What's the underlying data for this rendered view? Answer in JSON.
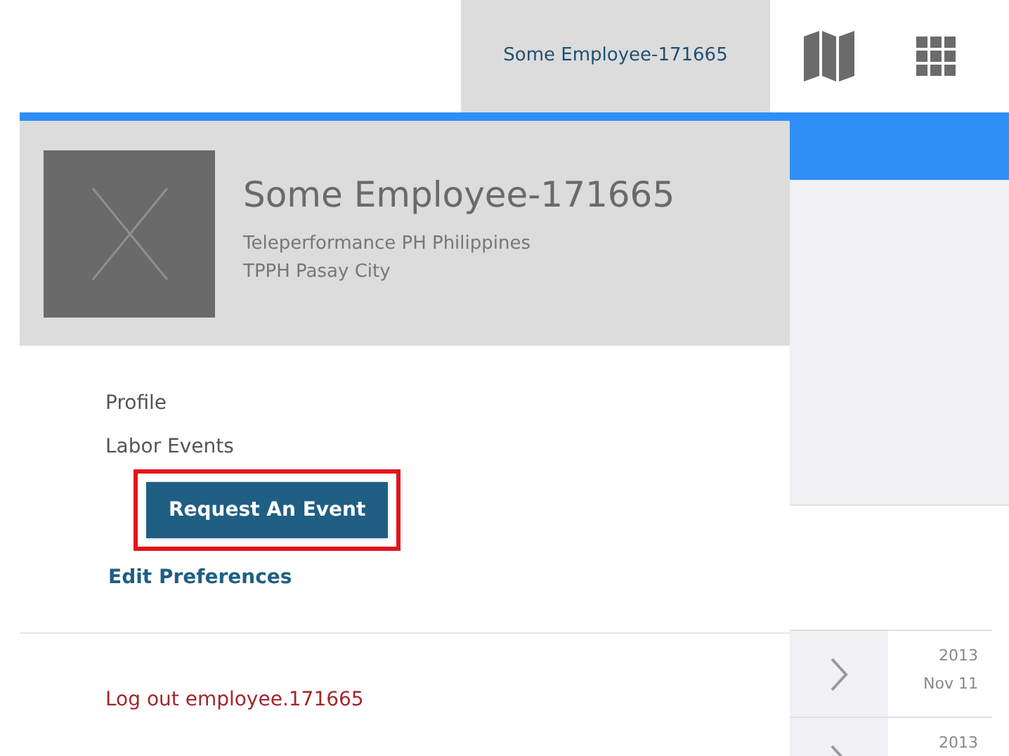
{
  "top_bar": {
    "user_tab": "Some Employee-171665"
  },
  "user_panel": {
    "name": "Some Employee-171665",
    "company": "Teleperformance PH Philippines",
    "site": "TPPH Pasay City",
    "menu": [
      {
        "kind": "item",
        "label": "Profile"
      },
      {
        "kind": "item",
        "label": "Labor Events"
      },
      {
        "kind": "highlighted_button",
        "label": "Request An Event"
      },
      {
        "kind": "link",
        "label": "Edit Preferences"
      }
    ],
    "logout": "Log out employee.171665"
  },
  "event_rows": [
    {
      "year": "2013",
      "day": "Nov 11"
    },
    {
      "year": "2013"
    }
  ]
}
